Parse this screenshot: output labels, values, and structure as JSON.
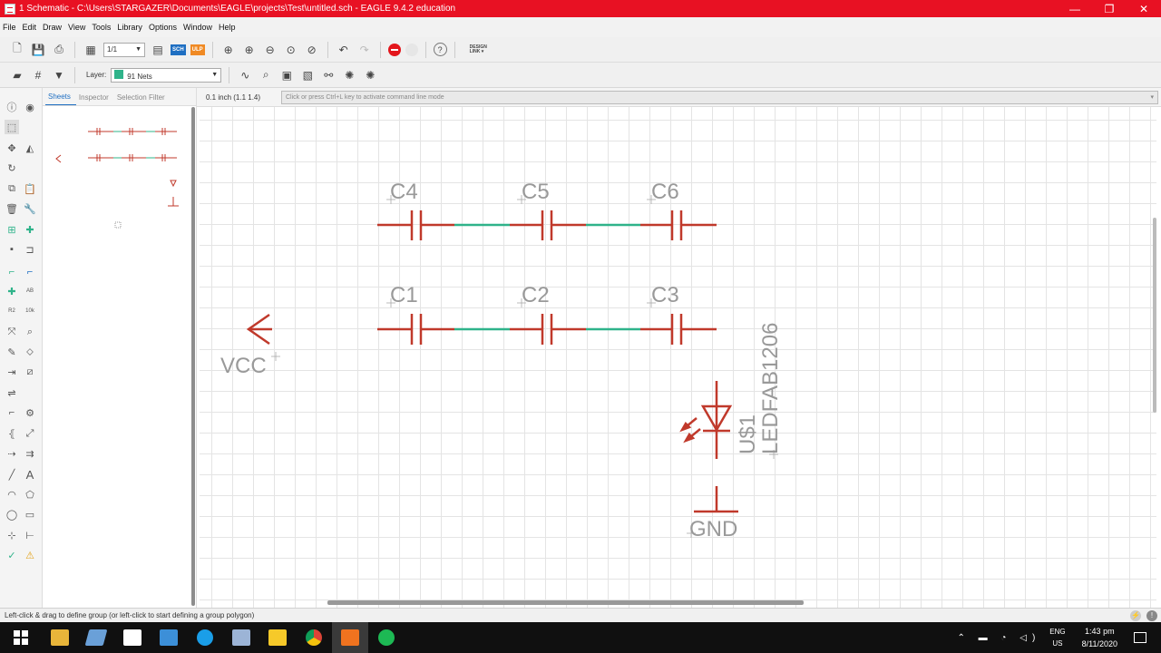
{
  "window": {
    "title": "1 Schematic - C:\\Users\\STARGAZER\\Documents\\EAGLE\\projects\\Test\\untitled.sch - EAGLE 9.4.2 education",
    "min_glyph": "—",
    "max_glyph": "❐",
    "close_glyph": "✕"
  },
  "menu": [
    "File",
    "Edit",
    "Draw",
    "View",
    "Tools",
    "Library",
    "Options",
    "Window",
    "Help"
  ],
  "toolbar": {
    "sheet_combo": "1/1",
    "sch_badge": "SCH",
    "ulp_badge": "ULP",
    "help": "?",
    "design_link_1": "DESIGN",
    "design_link_2": "LINK ▾"
  },
  "layer": {
    "label": "Layer:",
    "value": "91 Nets",
    "color": "#2fb38a"
  },
  "side_panel": {
    "tabs": [
      "Sheets",
      "Inspector",
      "Selection Filter"
    ]
  },
  "coords": "0.1 inch (1.1 1.4)",
  "command_line": {
    "placeholder": "Click or press Ctrl+L key to activate command line mode",
    "arrow": "▾"
  },
  "schematic": {
    "capacitors_top": [
      "C4",
      "C5",
      "C6"
    ],
    "capacitors_bottom": [
      "C1",
      "C2",
      "C3"
    ],
    "vcc_label": "VCC",
    "led_name": "U$1",
    "led_value": "LEDFAB1206",
    "gnd_label": "GND",
    "component_color": "#c0392b",
    "net_color": "#2fb38a",
    "label_color": "#999999"
  },
  "status": {
    "message": "Left-click & drag to define group (or left-click to start defining a group polygon)",
    "icon_1": "⚡",
    "icon_2": "!"
  },
  "taskbar": {
    "tray_glyphs": "⌃ ▬ ◔ ◁)",
    "lang_1": "ENG",
    "lang_2": "US",
    "time": "1:43 pm",
    "date": "8/11/2020"
  }
}
